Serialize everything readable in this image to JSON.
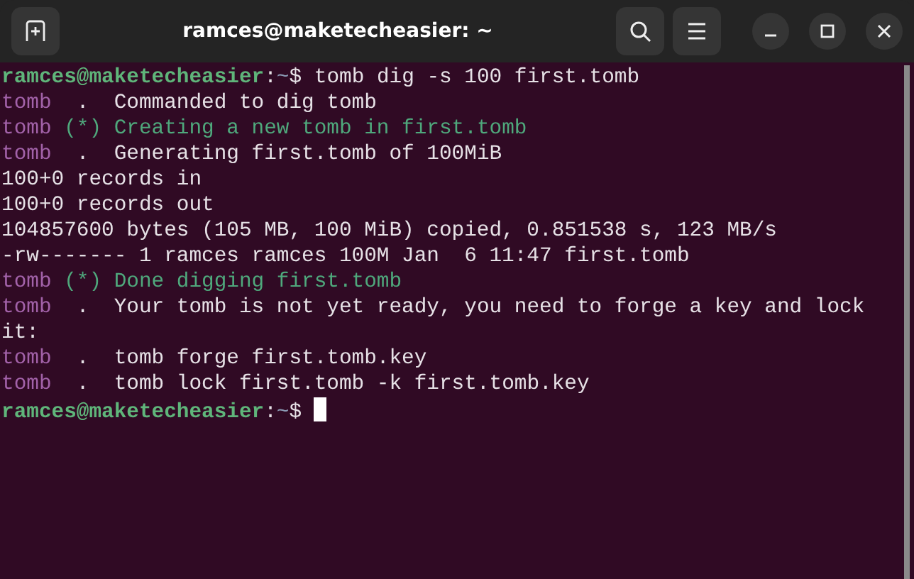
{
  "window": {
    "title": "ramces@maketecheasier: ~"
  },
  "terminal": {
    "lines": [
      [
        {
          "kind": "user",
          "text": "ramces@maketecheasier"
        },
        {
          "kind": "plain",
          "text": ":"
        },
        {
          "kind": "path",
          "text": "~"
        },
        {
          "kind": "plain",
          "text": "$ tomb dig -s 100 first.tomb"
        }
      ],
      [
        {
          "kind": "tag",
          "text": "tomb"
        },
        {
          "kind": "plain",
          "text": "  .  Commanded to dig tomb"
        }
      ],
      [
        {
          "kind": "tag",
          "text": "tomb"
        },
        {
          "kind": "ok",
          "text": " (*) Creating a new tomb in first.tomb"
        }
      ],
      [
        {
          "kind": "tag",
          "text": "tomb"
        },
        {
          "kind": "plain",
          "text": "  .  Generating first.tomb of 100MiB"
        }
      ],
      [
        {
          "kind": "plain",
          "text": "100+0 records in"
        }
      ],
      [
        {
          "kind": "plain",
          "text": "100+0 records out"
        }
      ],
      [
        {
          "kind": "plain",
          "text": "104857600 bytes (105 MB, 100 MiB) copied, 0.851538 s, 123 MB/s"
        }
      ],
      [
        {
          "kind": "plain",
          "text": "-rw------- 1 ramces ramces 100M Jan  6 11:47 first.tomb"
        }
      ],
      [
        {
          "kind": "tag",
          "text": "tomb"
        },
        {
          "kind": "ok",
          "text": " (*) Done digging first.tomb"
        }
      ],
      [
        {
          "kind": "tag",
          "text": "tomb"
        },
        {
          "kind": "plain",
          "text": "  .  Your tomb is not yet ready, you need to forge a key and lock"
        }
      ],
      [
        {
          "kind": "plain",
          "text": "it:"
        }
      ],
      [
        {
          "kind": "tag",
          "text": "tomb"
        },
        {
          "kind": "plain",
          "text": "  .  tomb forge first.tomb.key"
        }
      ],
      [
        {
          "kind": "tag",
          "text": "tomb"
        },
        {
          "kind": "plain",
          "text": "  .  tomb lock first.tomb -k first.tomb.key"
        }
      ],
      [
        {
          "kind": "user",
          "text": "ramces@maketecheasier"
        },
        {
          "kind": "plain",
          "text": ":"
        },
        {
          "kind": "path",
          "text": "~"
        },
        {
          "kind": "plain",
          "text": "$ "
        },
        {
          "kind": "cursor"
        }
      ]
    ]
  }
}
